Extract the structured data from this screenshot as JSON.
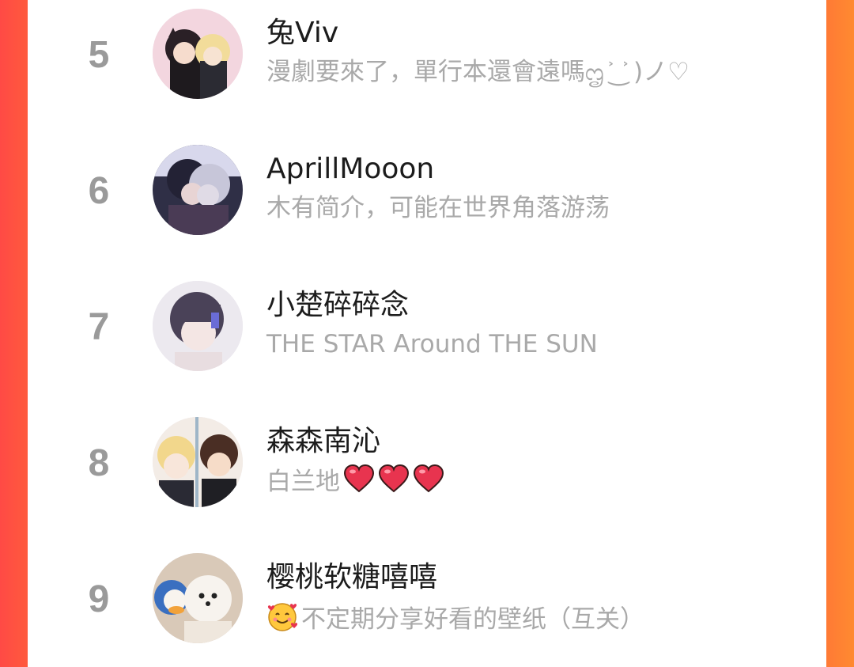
{
  "leaderboard": {
    "rows": [
      {
        "rank": "5",
        "name": "兔Viv",
        "bio": "漫劇要來了，單行本還會遠嗎ᦗ ͐ ͜ ͐ )ノ♡"
      },
      {
        "rank": "6",
        "name": "AprillMooon",
        "bio": "木有简介，可能在世界角落游荡"
      },
      {
        "rank": "7",
        "name": "小楚碎碎念",
        "bio": "THE STAR Around THE SUN"
      },
      {
        "rank": "8",
        "name": "森森南沁",
        "bio": "白兰地"
      },
      {
        "rank": "9",
        "name": "樱桃软糖嘻嘻",
        "bio": "不定期分享好看的壁纸（互关）"
      }
    ]
  },
  "colors": {
    "left_edge": "#ff4a45",
    "right_edge": "#ff8a30",
    "rank_text": "#9a9a9a",
    "name_text": "#1c1c1c",
    "bio_text": "#a9a9a9",
    "heart": "#e8344f"
  },
  "icons": {
    "row_8_bio_suffix": [
      "heart-icon",
      "heart-icon",
      "heart-icon"
    ],
    "row_9_bio_prefix": "smiling-face-with-hearts-icon"
  }
}
